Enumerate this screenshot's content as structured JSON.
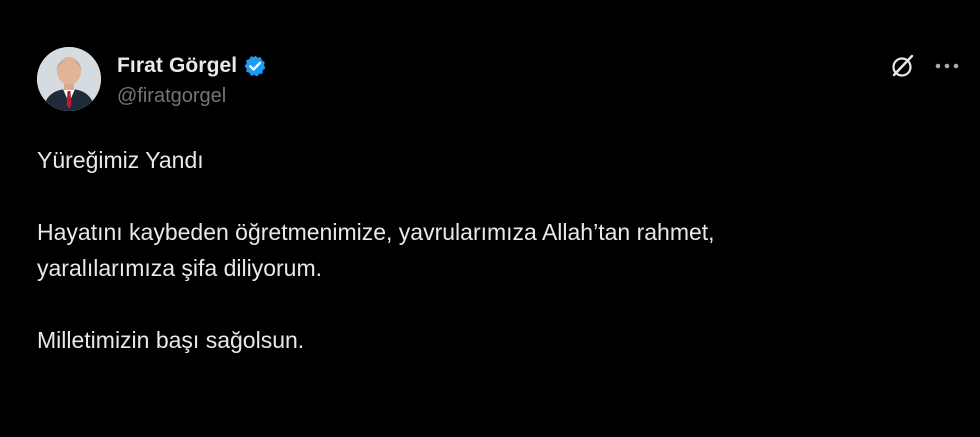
{
  "author": {
    "display_name": "Fırat Görgel",
    "handle": "@firatgorgel",
    "verified": true
  },
  "icons": {
    "avatar": "profile-photo",
    "verified": "verified-badge-icon",
    "grok": "grok-icon",
    "more": "more-options-icon"
  },
  "colors": {
    "background": "#000000",
    "text_primary": "#e7e9ea",
    "text_secondary": "#71767b",
    "verified_blue": "#1d9bf0"
  },
  "tweet": {
    "line1": "Yüreğimiz Yandı",
    "line2": "Hayatını kaybeden öğretmenimize, yavrularımıza Allah’tan rahmet,",
    "line3": "yaralılarımıza şifa diliyorum.",
    "line4": "Milletimizin başı sağolsun."
  }
}
